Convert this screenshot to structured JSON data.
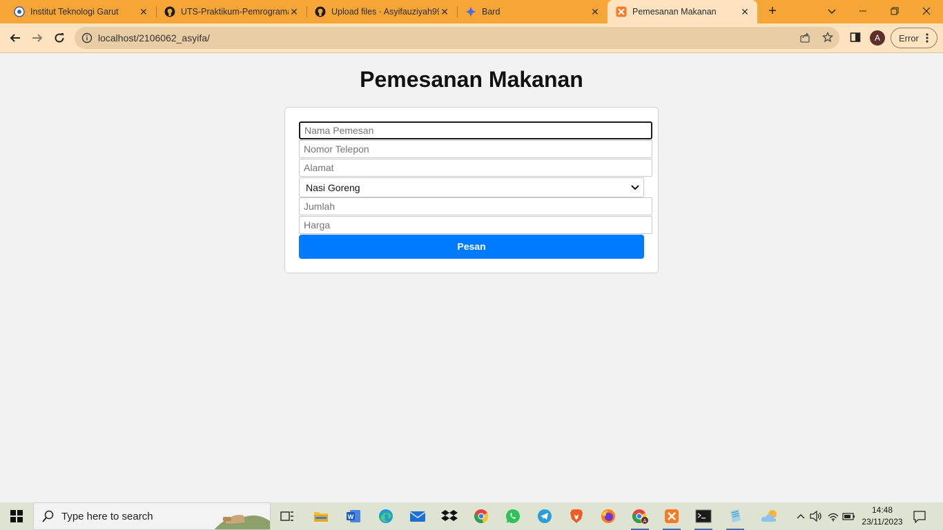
{
  "browser": {
    "tabs": [
      {
        "title": "Institut Teknologi Garut",
        "icon": "campus-logo-icon",
        "active": false
      },
      {
        "title": "UTS-Praktikum-Pemrograma",
        "icon": "github-icon",
        "active": false
      },
      {
        "title": "Upload files · Asyifauziyah99",
        "icon": "github-icon",
        "active": false
      },
      {
        "title": "Bard",
        "icon": "bard-sparkle-icon",
        "active": false
      },
      {
        "title": "Pemesanan Makanan",
        "icon": "xampp-icon",
        "active": true
      }
    ],
    "new_tab_label": "+",
    "url": "localhost/2106062_asyifa/",
    "profile_initial": "A",
    "error_label": "Error"
  },
  "page": {
    "title": "Pemesanan Makanan",
    "form": {
      "nama_placeholder": "Nama Pemesan",
      "telepon_placeholder": "Nomor Telepon",
      "alamat_placeholder": "Alamat",
      "menu_selected": "Nasi Goreng",
      "jumlah_placeholder": "Jumlah",
      "harga_placeholder": "Harga",
      "submit_label": "Pesan"
    }
  },
  "taskbar": {
    "search_placeholder": "Type here to search",
    "apps": [
      "task-view",
      "file-explorer",
      "word",
      "edge",
      "mail",
      "dropbox",
      "chrome",
      "whatsapp",
      "telegram",
      "brave",
      "firefox",
      "chrome-profile",
      "xampp",
      "terminal",
      "notepad"
    ],
    "time": "14:48",
    "date": "23/11/2023"
  },
  "colors": {
    "tab_strip": "#f6a637",
    "toolbar": "#fde3c0",
    "submit_button": "#007bff"
  }
}
